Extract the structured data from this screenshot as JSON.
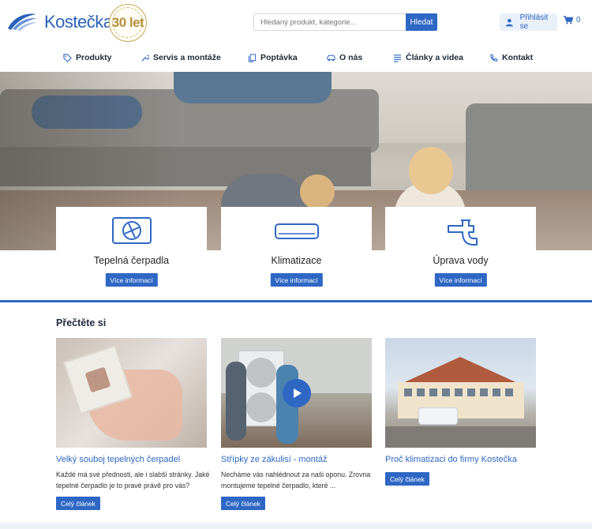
{
  "brand": {
    "name": "Kostečka",
    "badge_line": "30 let",
    "color": "#2e67c4"
  },
  "search": {
    "placeholder": "Hledaný produkt, kategorie...",
    "button_label": "Hledat"
  },
  "account": {
    "login_label": "Přihlásit se",
    "cart_count": "0"
  },
  "nav": {
    "items": [
      {
        "label": "Produkty",
        "icon": "tag-icon"
      },
      {
        "label": "Servis a montáže",
        "icon": "wrench-icon"
      },
      {
        "label": "Poptávka",
        "icon": "copy-icon"
      },
      {
        "label": "O nás",
        "icon": "car-icon"
      },
      {
        "label": "Články a videa",
        "icon": "list-icon"
      },
      {
        "label": "Kontakt",
        "icon": "phone-icon"
      }
    ]
  },
  "services": [
    {
      "title": "Tepelná čerpadla",
      "button": "Více informací",
      "icon": "heat-pump-icon"
    },
    {
      "title": "Klimatizace",
      "button": "Více informací",
      "icon": "air-conditioner-icon"
    },
    {
      "title": "Úprava vody",
      "button": "Více informací",
      "icon": "faucet-icon"
    }
  ],
  "articles_section": {
    "title": "Přečtěte si",
    "articles": [
      {
        "title": "Velký souboj tepelných čerpadel",
        "description": "Každé má své přednosti, ale i slabší stránky. Jaké tepelné čerpadlo je to pravé právě pro vás?",
        "button": "Celý článek"
      },
      {
        "title": "Střípky ze zákulisí - montáž",
        "description": "Necháme vás nahlédnout za naši oponu. Zrovna montujeme tepelné čerpadlo, které ...",
        "button": "Celý článek"
      },
      {
        "title": "Proč klimatizaci do firmy Kostečka",
        "description": "",
        "button": "Celý článek"
      }
    ]
  }
}
